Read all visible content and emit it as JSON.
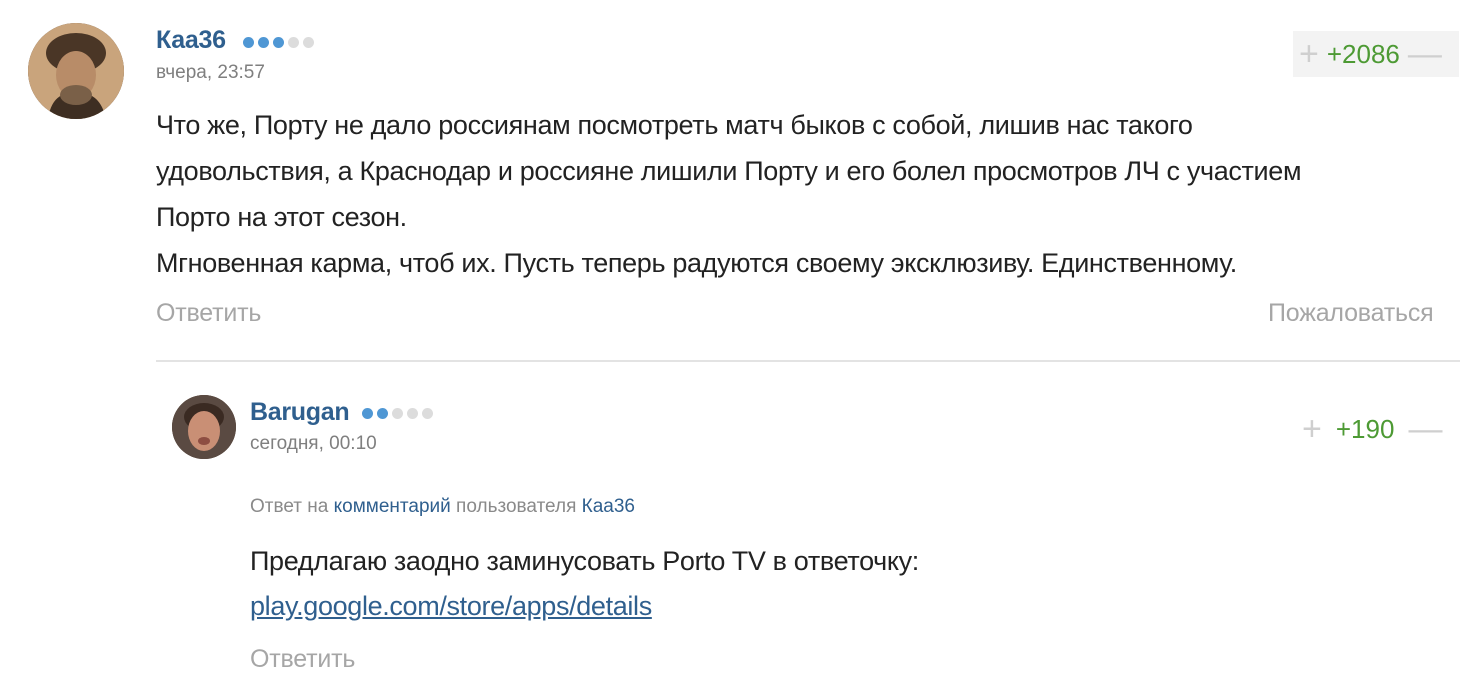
{
  "comments": [
    {
      "author": "Каа36",
      "rank_dots": 5,
      "rank_dots_active": 3,
      "time": "вчера, 23:57",
      "rating": "+2086",
      "text_lines": [
        "Что же, Порту не дало россиянам посмотреть матч быков с собой, лишив нас такого",
        "удовольствия, а Краснодар и россияне лишили Порту и его болел просмотров ЛЧ с участием",
        "Порто на этот сезон.",
        "Мгновенная карма, чтоб их. Пусть теперь радуются своему эксклюзиву. Единственному."
      ],
      "reply_label": "Ответить",
      "report_label": "Пожаловаться",
      "avatar_icon": "user-avatar-photo"
    },
    {
      "author": "Barugan",
      "rank_dots": 5,
      "rank_dots_active": 2,
      "time": "сегодня, 00:10",
      "rating": "+190",
      "reply_info": {
        "prefix": "Ответ на",
        "link_text": "комментарий",
        "middle": "пользователя",
        "user": "Каа36"
      },
      "text_lines": [
        "Предлагаю заодно заминусовать Porto TV в ответочку:"
      ],
      "link": "play.google.com/store/apps/details",
      "reply_label": "Ответить",
      "avatar_icon": "user-avatar-photo"
    }
  ],
  "colors": {
    "username": "#2f5f8e",
    "rating_positive": "#4d9a34",
    "rank_dot_active": "#4f97d4",
    "muted": "#a6a6a6"
  }
}
